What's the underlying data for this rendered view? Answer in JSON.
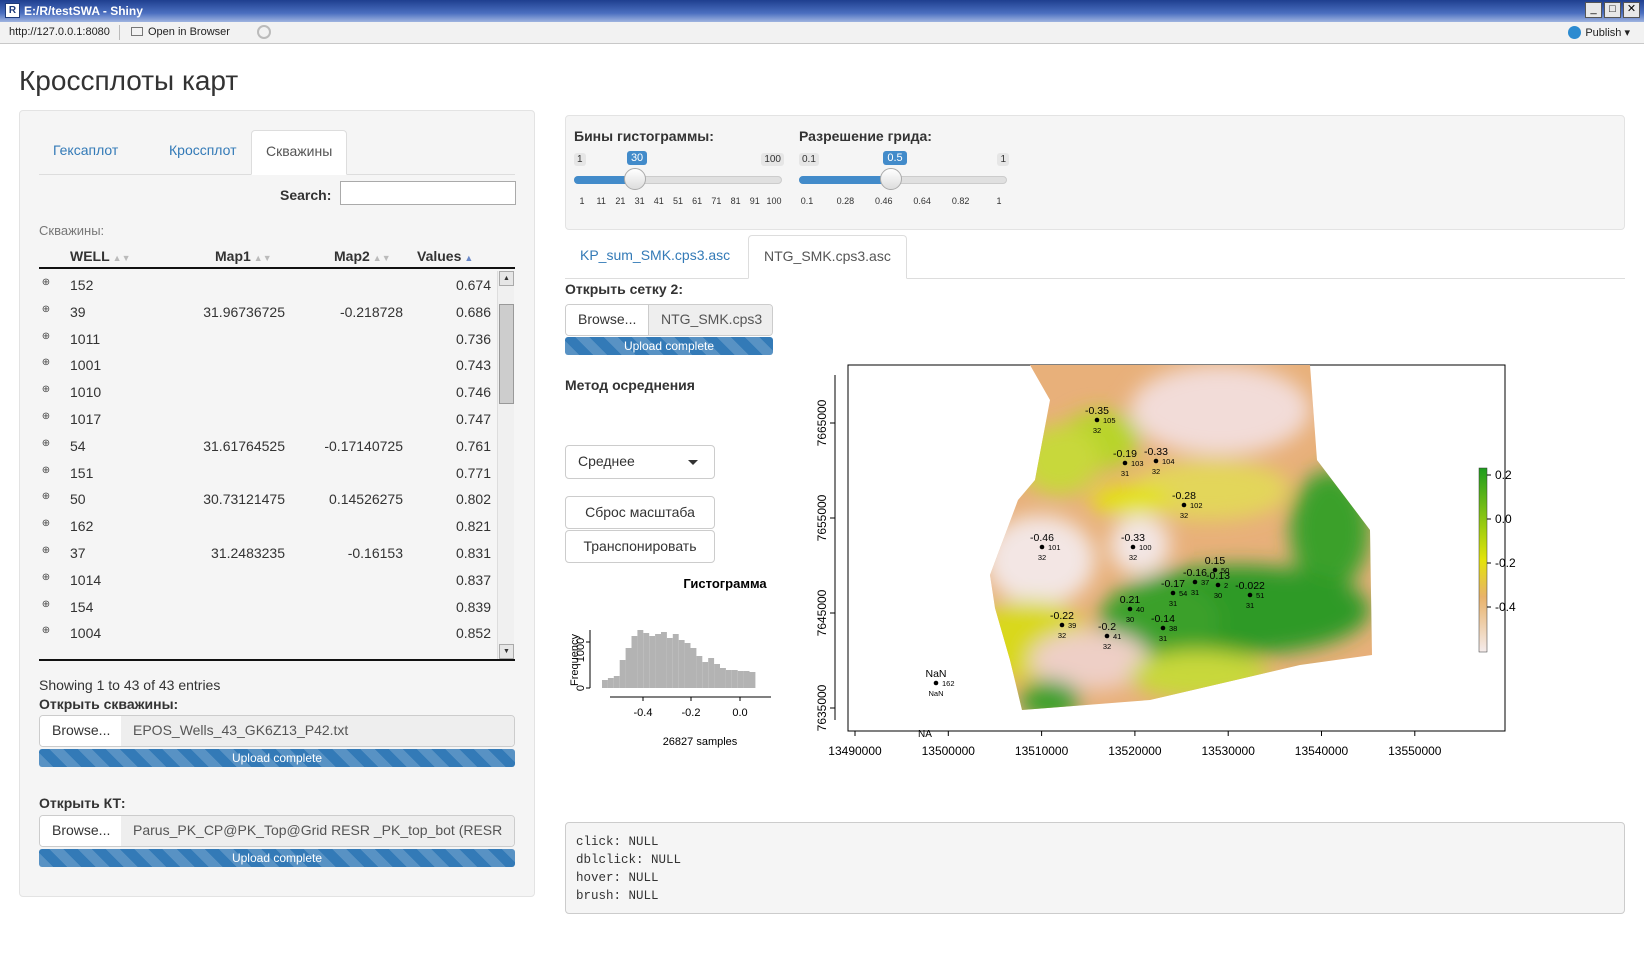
{
  "window": {
    "title": "E:/R/testSWA - Shiny",
    "controls": [
      "_",
      "□",
      "✕"
    ]
  },
  "toolbar": {
    "url": "http://127.0.0.1:8080",
    "open_in_browser": "Open in Browser",
    "publish": "Publish ▾"
  },
  "page_title": "Кроссплоты карт",
  "sidebar": {
    "tabs": [
      {
        "label": "Гексаплот",
        "active": false
      },
      {
        "label": "Кроссплот",
        "active": false
      },
      {
        "label": "Скважины",
        "active": true
      }
    ],
    "search_label": "Search:",
    "search_value": "",
    "table_caption": "Скважины:",
    "columns": [
      "WELL",
      "Map1",
      "Map2",
      "Values"
    ],
    "rows": [
      {
        "well": "152",
        "map1": "",
        "map2": "",
        "values": "0.674"
      },
      {
        "well": "39",
        "map1": "31.96736725",
        "map2": "-0.218728",
        "values": "0.686"
      },
      {
        "well": "1011",
        "map1": "",
        "map2": "",
        "values": "0.736"
      },
      {
        "well": "1001",
        "map1": "",
        "map2": "",
        "values": "0.743"
      },
      {
        "well": "1010",
        "map1": "",
        "map2": "",
        "values": "0.746"
      },
      {
        "well": "1017",
        "map1": "",
        "map2": "",
        "values": "0.747"
      },
      {
        "well": "54",
        "map1": "31.61764525",
        "map2": "-0.17140725",
        "values": "0.761"
      },
      {
        "well": "151",
        "map1": "",
        "map2": "",
        "values": "0.771"
      },
      {
        "well": "50",
        "map1": "30.73121475",
        "map2": "0.14526275",
        "values": "0.802"
      },
      {
        "well": "162",
        "map1": "",
        "map2": "",
        "values": "0.821"
      },
      {
        "well": "37",
        "map1": "31.2483235",
        "map2": "-0.16153",
        "values": "0.831"
      },
      {
        "well": "1014",
        "map1": "",
        "map2": "",
        "values": "0.837"
      },
      {
        "well": "154",
        "map1": "",
        "map2": "",
        "values": "0.839"
      },
      {
        "well": "1004",
        "map1": "",
        "map2": "",
        "values": "0.852"
      }
    ],
    "info": "Showing 1 to 43 of 43 entries",
    "wells_file": {
      "label": "Открыть скважины:",
      "browse": "Browse...",
      "filename": "EPOS_Wells_43_GK6Z13_P42.txt",
      "progress": "Upload complete"
    },
    "kt_file": {
      "label": "Открыть КТ:",
      "browse": "Browse...",
      "filename": "Parus_PK_CP@PK_Top@Grid RESR _PK_top_bot (RESR",
      "progress": "Upload complete"
    }
  },
  "sliders": {
    "bins": {
      "label": "Бины гистограммы:",
      "min": "1",
      "max": "100",
      "value": "30",
      "level": 0.293,
      "ticks": [
        "1",
        "11",
        "21",
        "31",
        "41",
        "51",
        "61",
        "71",
        "81",
        "91",
        "100"
      ]
    },
    "grid": {
      "label": "Разрешение грида:",
      "min": "0.1",
      "max": "1",
      "value": "0.5",
      "level": 0.444,
      "ticks": [
        "0.1",
        "0.28",
        "0.46",
        "0.64",
        "0.82",
        "1"
      ]
    }
  },
  "main_tabs": [
    {
      "label": "KP_sum_SMK.cps3.asc",
      "active": false
    },
    {
      "label": "NTG_SMK.cps3.asc",
      "active": true
    }
  ],
  "grid2": {
    "label": "Открыть сетку 2:",
    "browse": "Browse...",
    "filename": "NTG_SMK.cps3",
    "progress": "Upload complete"
  },
  "method": {
    "label": "Метод осреднения",
    "value": "Среднее"
  },
  "buttons": {
    "reset": "Сброс масштаба",
    "transpose": "Транспонировать"
  },
  "histogram": {
    "title": "Гистограмма",
    "ylabel": "Frequency",
    "yticks": [
      "0",
      "1000"
    ],
    "xticks": [
      "-0.4",
      "-0.2",
      "0.0"
    ],
    "subtitle": "26827 samples"
  },
  "map": {
    "xticks": [
      "13490000",
      "13500000",
      "13510000",
      "13520000",
      "13530000",
      "13540000",
      "13550000"
    ],
    "yticks": [
      "7635000",
      "7645000",
      "7655000",
      "7665000"
    ],
    "legend": [
      "0.2",
      "0.0",
      "-0.2",
      "-0.4"
    ],
    "wells": [
      {
        "v": "-0.35",
        "id": "105",
        "n": "32"
      },
      {
        "v": "-0.19",
        "id": "103",
        "n": "31"
      },
      {
        "v": "-0.33",
        "id": "104",
        "n": "32"
      },
      {
        "v": "-0.28",
        "id": "102",
        "n": "32"
      },
      {
        "v": "-0.46",
        "id": "101",
        "n": "32"
      },
      {
        "v": "-0.33",
        "id": "100",
        "n": "32"
      },
      {
        "v": "0.15",
        "id": "50",
        "n": ""
      },
      {
        "v": "-0.16",
        "id": "37",
        "n": "31"
      },
      {
        "v": "-0.13",
        "id": "2",
        "n": "30"
      },
      {
        "v": "-0.17",
        "id": "54",
        "n": "31"
      },
      {
        "v": "-0.022",
        "id": "51",
        "n": "31"
      },
      {
        "v": "0.21",
        "id": "40",
        "n": "30"
      },
      {
        "v": "-0.22",
        "id": "39",
        "n": "32"
      },
      {
        "v": "-0.2",
        "id": "41",
        "n": "32"
      },
      {
        "v": "-0.14",
        "id": "38",
        "n": "31"
      },
      {
        "v": "NaN",
        "id": "162",
        "n": "NaN"
      }
    ],
    "na_label": "NA"
  },
  "events": [
    "click: NULL",
    "dblclick: NULL",
    "hover: NULL",
    "brush: NULL"
  ]
}
